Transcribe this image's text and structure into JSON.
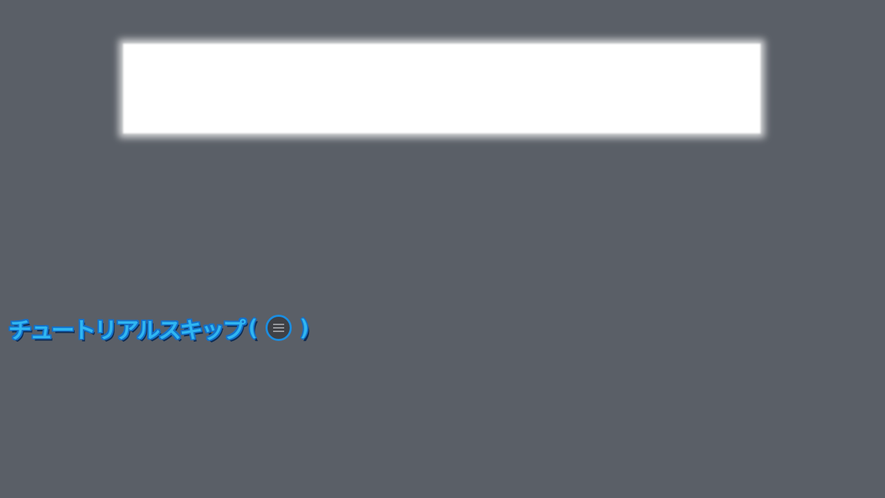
{
  "tutorial_skip": {
    "label": "チュートリアルスキップ",
    "open_bracket": "(",
    "close_bracket": ")",
    "button_icon": "hamburger-menu-icon"
  },
  "colors": {
    "background": "#5a5f67",
    "banner": "#ffffff",
    "text_fill": "#2fb6f2",
    "text_outline": "#1570c8",
    "button_fill": "#3f4146",
    "button_ring": "#1b8de0"
  }
}
